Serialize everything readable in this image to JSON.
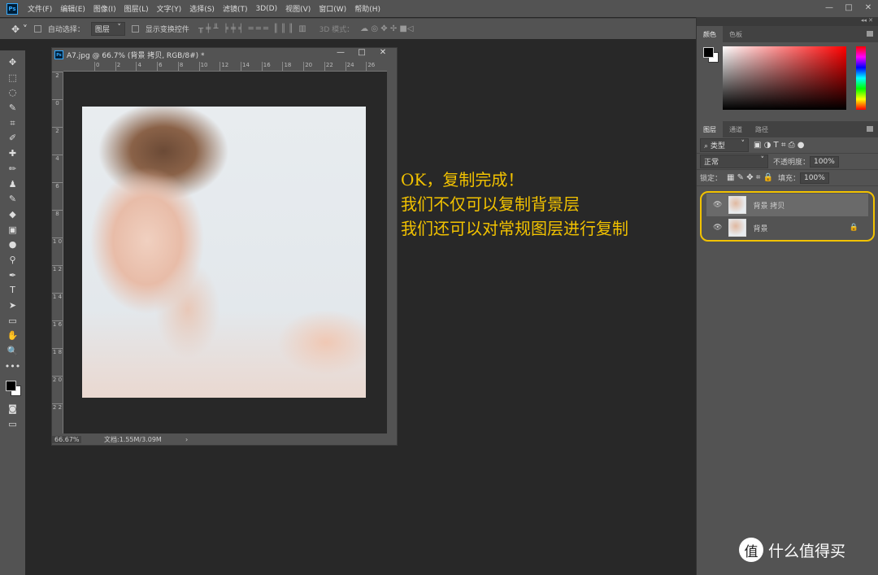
{
  "menubar": {
    "logo": "Ps",
    "items": [
      "文件(F)",
      "编辑(E)",
      "图像(I)",
      "图层(L)",
      "文字(Y)",
      "选择(S)",
      "滤镜(T)",
      "3D(D)",
      "视图(V)",
      "窗口(W)",
      "帮助(H)"
    ],
    "window_controls": [
      "—",
      "□",
      "✕"
    ]
  },
  "options": {
    "auto_select_label": "自动选择：",
    "auto_select_value": "图层",
    "show_transform_label": "显示变换控件",
    "mode_3d_label": "3D 模式："
  },
  "tools": [
    "✥",
    "⬚",
    "◌",
    "✎",
    "⌗",
    "✐",
    "✚",
    "✏",
    "♟",
    "✎",
    "◆",
    "▣",
    "●",
    "⚲",
    "✒",
    "T",
    "➤",
    "▭",
    "✋",
    "🔍",
    "•••"
  ],
  "document": {
    "title": "A7.jpg @ 66.7% (背景 拷贝, RGB/8#) *",
    "ruler_h": [
      "0",
      "2",
      "4",
      "6",
      "8",
      "10",
      "12",
      "14",
      "16",
      "18",
      "20",
      "22",
      "24",
      "26"
    ],
    "ruler_v": [
      "2",
      "0",
      "2",
      "4",
      "6",
      "8",
      "1 0",
      "1 2",
      "1 4",
      "1 6",
      "1 8",
      "2 0",
      "2 2",
      "2 4",
      "2 6"
    ],
    "zoom": "66.67%",
    "doc_size": "文档:1.55M/3.09M"
  },
  "color_panel": {
    "tabs": [
      "颜色",
      "色板"
    ]
  },
  "layers_panel": {
    "tabs": [
      "图层",
      "通道",
      "路径"
    ],
    "filter": "类型",
    "blend_mode": "正常",
    "opacity_label": "不透明度：",
    "opacity": "100%",
    "lock_label": "锁定：",
    "fill_label": "填充：",
    "fill": "100%",
    "layers": [
      {
        "name": "背景 拷贝",
        "selected": true,
        "locked": false
      },
      {
        "name": "背景",
        "selected": false,
        "locked": true
      }
    ]
  },
  "callout": {
    "line1": "OK，复制完成！",
    "line2": "我们不仅可以复制背景层",
    "line3": "我们还可以对常规图层进行复制",
    "color": "#f2c200"
  },
  "watermark": {
    "text": "什么值得买",
    "badge": "值"
  }
}
